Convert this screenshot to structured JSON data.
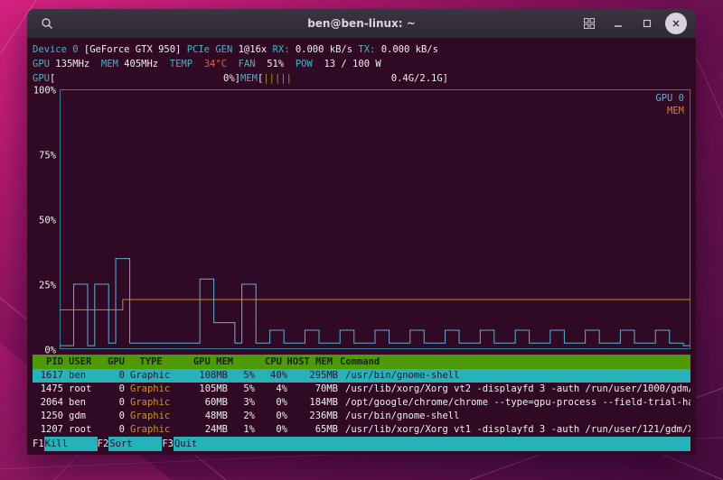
{
  "window": {
    "title": "ben@ben-linux: ~"
  },
  "titlebar_icons": [
    "search-icon",
    "window-grid-icon",
    "minimize-icon",
    "maximize-icon",
    "close-icon"
  ],
  "header": {
    "line1": [
      {
        "t": "Device 0 ",
        "c": "cyan"
      },
      {
        "t": "[GeForce GTX 950] ",
        "c": "white"
      },
      {
        "t": "PCIe ",
        "c": "cyan"
      },
      {
        "t": "GEN ",
        "c": "cyan"
      },
      {
        "t": "1@16x ",
        "c": "white"
      },
      {
        "t": "RX: ",
        "c": "cyan"
      },
      {
        "t": "0.000 kB/s ",
        "c": "white"
      },
      {
        "t": "TX: ",
        "c": "cyan"
      },
      {
        "t": "0.000 kB/s",
        "c": "white"
      }
    ],
    "line2": [
      {
        "t": "GPU ",
        "c": "cyan"
      },
      {
        "t": "135MHz  ",
        "c": "white"
      },
      {
        "t": "MEM ",
        "c": "cyan"
      },
      {
        "t": "405MHz  ",
        "c": "white"
      },
      {
        "t": "TEMP  ",
        "c": "cyan"
      },
      {
        "t": "34°C  ",
        "c": "red"
      },
      {
        "t": "FAN  ",
        "c": "cyan"
      },
      {
        "t": "51%  ",
        "c": "white"
      },
      {
        "t": "POW  ",
        "c": "cyan"
      },
      {
        "t": "13 / 100 W",
        "c": "white"
      }
    ]
  },
  "meters": [
    {
      "label": "GPU",
      "bars": "",
      "value": "0%"
    },
    {
      "label": "MEM",
      "bars": "|||||",
      "value": "0.4G/2.1G"
    }
  ],
  "chart_data": {
    "type": "line",
    "style": "step",
    "ylim": [
      0,
      100
    ],
    "ytick_labels": [
      "100%",
      "75%",
      "50%",
      "25%",
      "0%"
    ],
    "border_color": "#2b7f96",
    "legend_position": "top-right",
    "legend": [
      {
        "name": "GPU 0",
        "color": "#63aed6"
      },
      {
        "name": "MEM",
        "color": "#c8881e"
      }
    ],
    "series": [
      {
        "name": "GPU 0",
        "color": "#63aed6",
        "values": [
          1,
          1,
          25,
          25,
          1,
          25,
          25,
          2,
          35,
          35,
          2,
          2,
          2,
          2,
          2,
          2,
          2,
          2,
          2,
          2,
          27,
          27,
          10,
          10,
          10,
          2,
          25,
          25,
          2,
          2,
          7,
          7,
          2,
          2,
          2,
          7,
          7,
          2,
          2,
          2,
          7,
          7,
          2,
          2,
          2,
          7,
          7,
          2,
          2,
          2,
          7,
          7,
          2,
          2,
          2,
          7,
          7,
          2,
          2,
          2,
          7,
          7,
          2,
          2,
          2,
          7,
          7,
          2,
          2,
          2,
          7,
          7,
          2,
          2,
          2,
          7,
          7,
          2,
          2,
          2,
          7,
          7,
          2,
          2,
          2,
          7,
          7,
          2,
          2,
          1
        ]
      },
      {
        "name": "MEM",
        "color": "#c8881e",
        "values": [
          15,
          15,
          15,
          15,
          15,
          15,
          15,
          15,
          15,
          19,
          19,
          19,
          19,
          19,
          19,
          19,
          19,
          19,
          19,
          19,
          19,
          19,
          19,
          19,
          19,
          19,
          19,
          19,
          19,
          19,
          19,
          19,
          19,
          19,
          19,
          19,
          19,
          19,
          19,
          19,
          19,
          19,
          19,
          19,
          19,
          19,
          19,
          19,
          19,
          19,
          19,
          19,
          19,
          19,
          19,
          19,
          19,
          19,
          19,
          19,
          19,
          19,
          19,
          19,
          19,
          19,
          19,
          19,
          19,
          19,
          19,
          19,
          19,
          19,
          19,
          19,
          19,
          19,
          19,
          19,
          19,
          19,
          19,
          19,
          19,
          19,
          19,
          19,
          19,
          19
        ]
      }
    ]
  },
  "table": {
    "headers": [
      "PID",
      "USER",
      "GPU",
      "TYPE",
      "GPU MEM",
      "CPU",
      "HOST MEM",
      "Command"
    ],
    "rows": [
      {
        "pid": "1617",
        "user": "ben",
        "gpu": "0",
        "type": "Graphic",
        "gpu_mem": "108MB",
        "mem_pct": "5%",
        "cpu": "40%",
        "host_mem": "295MB",
        "command": "/usr/bin/gnome-shell",
        "selected": true
      },
      {
        "pid": "1475",
        "user": "root",
        "gpu": "0",
        "type": "Graphic",
        "gpu_mem": "105MB",
        "mem_pct": "5%",
        "cpu": "4%",
        "host_mem": "70MB",
        "command": "/usr/lib/xorg/Xorg vt2 -displayfd 3 -auth /run/user/1000/gdm/",
        "selected": false
      },
      {
        "pid": "2064",
        "user": "ben",
        "gpu": "0",
        "type": "Graphic",
        "gpu_mem": "60MB",
        "mem_pct": "3%",
        "cpu": "0%",
        "host_mem": "184MB",
        "command": "/opt/google/chrome/chrome --type=gpu-process --field-trial-ha",
        "selected": false
      },
      {
        "pid": "1250",
        "user": "gdm",
        "gpu": "0",
        "type": "Graphic",
        "gpu_mem": "48MB",
        "mem_pct": "2%",
        "cpu": "0%",
        "host_mem": "236MB",
        "command": "/usr/bin/gnome-shell",
        "selected": false
      },
      {
        "pid": "1207",
        "user": "root",
        "gpu": "0",
        "type": "Graphic",
        "gpu_mem": "24MB",
        "mem_pct": "1%",
        "cpu": "0%",
        "host_mem": "65MB",
        "command": "/usr/lib/xorg/Xorg vt1 -displayfd 3 -auth /run/user/121/gdm/X",
        "selected": false
      }
    ]
  },
  "fkeys": [
    {
      "key": "F1",
      "label": "Kill"
    },
    {
      "key": "F2",
      "label": "Sort"
    },
    {
      "key": "F3",
      "label": "Quit"
    }
  ]
}
